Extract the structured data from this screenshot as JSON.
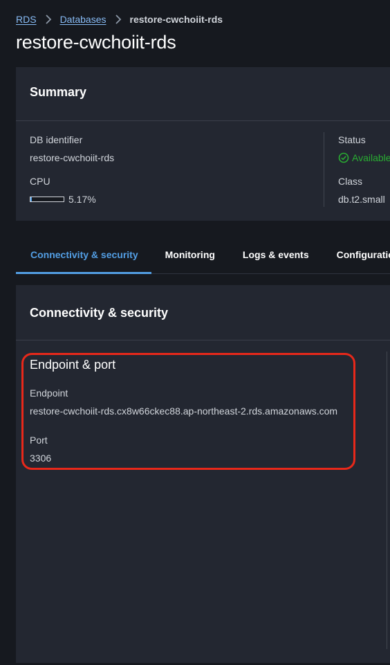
{
  "breadcrumb": {
    "items": [
      {
        "label": "RDS"
      },
      {
        "label": "Databases"
      },
      {
        "label": "restore-cwchoiit-rds"
      }
    ]
  },
  "page": {
    "title": "restore-cwchoiit-rds"
  },
  "summary": {
    "title": "Summary",
    "db_identifier_label": "DB identifier",
    "db_identifier_value": "restore-cwchoiit-rds",
    "cpu_label": "CPU",
    "cpu_value": "5.17%",
    "cpu_fraction": 0.0517,
    "status_label": "Status",
    "status_value": "Available",
    "class_label": "Class",
    "class_value": "db.t2.small"
  },
  "tabs": [
    {
      "label": "Connectivity & security",
      "active": true
    },
    {
      "label": "Monitoring",
      "active": false
    },
    {
      "label": "Logs & events",
      "active": false
    },
    {
      "label": "Configuration",
      "active": false
    }
  ],
  "connectivity": {
    "title": "Connectivity & security",
    "section_title": "Endpoint & port",
    "endpoint_label": "Endpoint",
    "endpoint_value": "restore-cwchoiit-rds.cx8w66ckec88.ap-northeast-2.rds.amazonaws.com",
    "port_label": "Port",
    "port_value": "3306"
  },
  "colors": {
    "link": "#89bdf7",
    "accent": "#539fe5",
    "success": "#29ad32",
    "highlight": "#e8281a"
  }
}
